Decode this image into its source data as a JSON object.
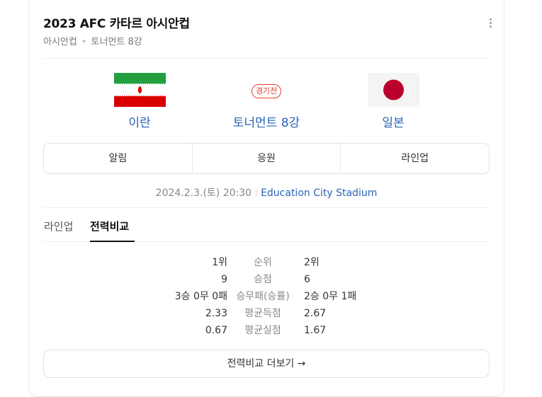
{
  "header": {
    "title": "2023 AFC 카타르 아시안컵",
    "breadcrumb": [
      "아시안컵",
      "토너먼트 8강"
    ]
  },
  "match": {
    "home": {
      "name": "이란",
      "flag": "iran-flag"
    },
    "away": {
      "name": "일본",
      "flag": "japan-flag"
    },
    "badge": "경기전",
    "round": "토너먼트 8강",
    "datetime": "2024.2.3.(토) 20:30",
    "venue": "Education City Stadium"
  },
  "actions": [
    "알림",
    "응원",
    "라인업"
  ],
  "tabs": [
    "라인업",
    "전력비교"
  ],
  "active_tab": "전력비교",
  "comparison": [
    {
      "label": "순위",
      "home": "1위",
      "away": "2위"
    },
    {
      "label": "승점",
      "home": "9",
      "away": "6"
    },
    {
      "label": "승무패(승률)",
      "home": "3승 0무 0패",
      "away": "2승 0무 1패"
    },
    {
      "label": "평균득점",
      "home": "2.33",
      "away": "2.67"
    },
    {
      "label": "평균실점",
      "home": "0.67",
      "away": "1.67"
    }
  ],
  "more_button": "전력비교 더보기",
  "colors": {
    "link": "#2a62b8",
    "badge": "#e0422f"
  }
}
